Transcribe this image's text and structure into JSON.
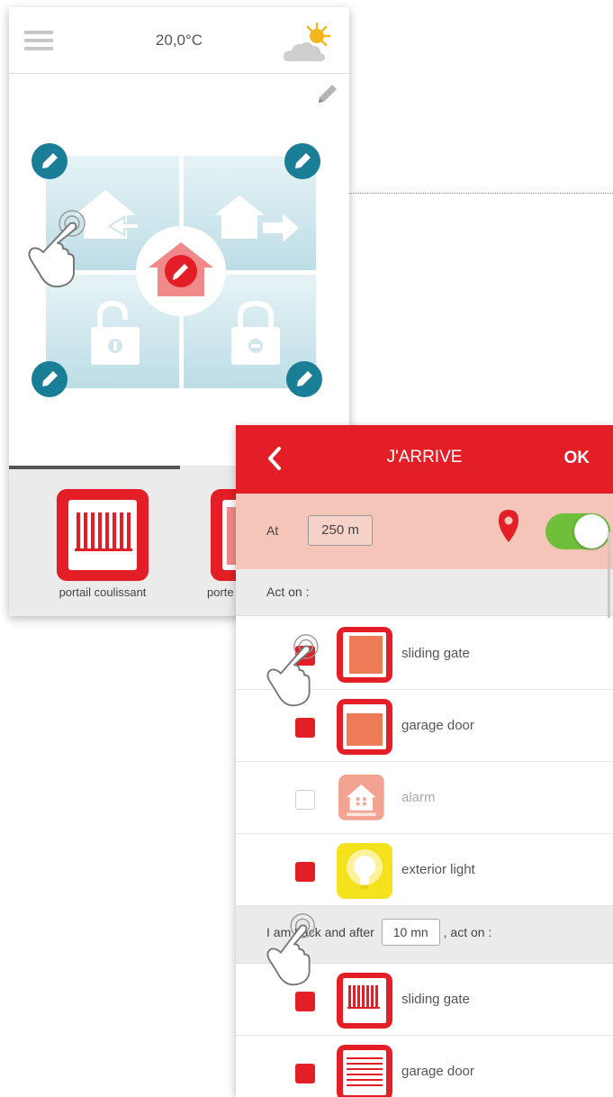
{
  "home": {
    "temperature": "20,0°C",
    "devices": [
      {
        "label": "portail coulissant"
      },
      {
        "label": "porte"
      }
    ]
  },
  "scenario": {
    "back_icon": "chevron-left-icon",
    "title": "J'ARRIVE",
    "ok_label": "OK",
    "at_label": "At",
    "distance": "250 m",
    "geofence_enabled": true,
    "act_on_label": "Act on :",
    "arrive_items": [
      {
        "label": "sliding gate",
        "checked": true,
        "icon": "sliding-gate-icon"
      },
      {
        "label": "garage door",
        "checked": true,
        "icon": "garage-door-icon"
      },
      {
        "label": "alarm",
        "checked": false,
        "icon": "alarm-icon"
      },
      {
        "label": "exterior light",
        "checked": true,
        "icon": "light-bulb-icon"
      }
    ],
    "back_prefix": "I am back and after",
    "delay": "10 mn",
    "back_suffix": ", act on :",
    "back_items": [
      {
        "label": "sliding gate",
        "checked": true,
        "icon": "sliding-gate-icon"
      },
      {
        "label": "garage door",
        "checked": true,
        "icon": "garage-door-icon"
      }
    ]
  },
  "colors": {
    "brand_red": "#e41e26",
    "salmon": "#f5c5b9",
    "teal": "#1a7e96",
    "toggle_green": "#6fbf3a",
    "light_yellow": "#f4e21c"
  }
}
